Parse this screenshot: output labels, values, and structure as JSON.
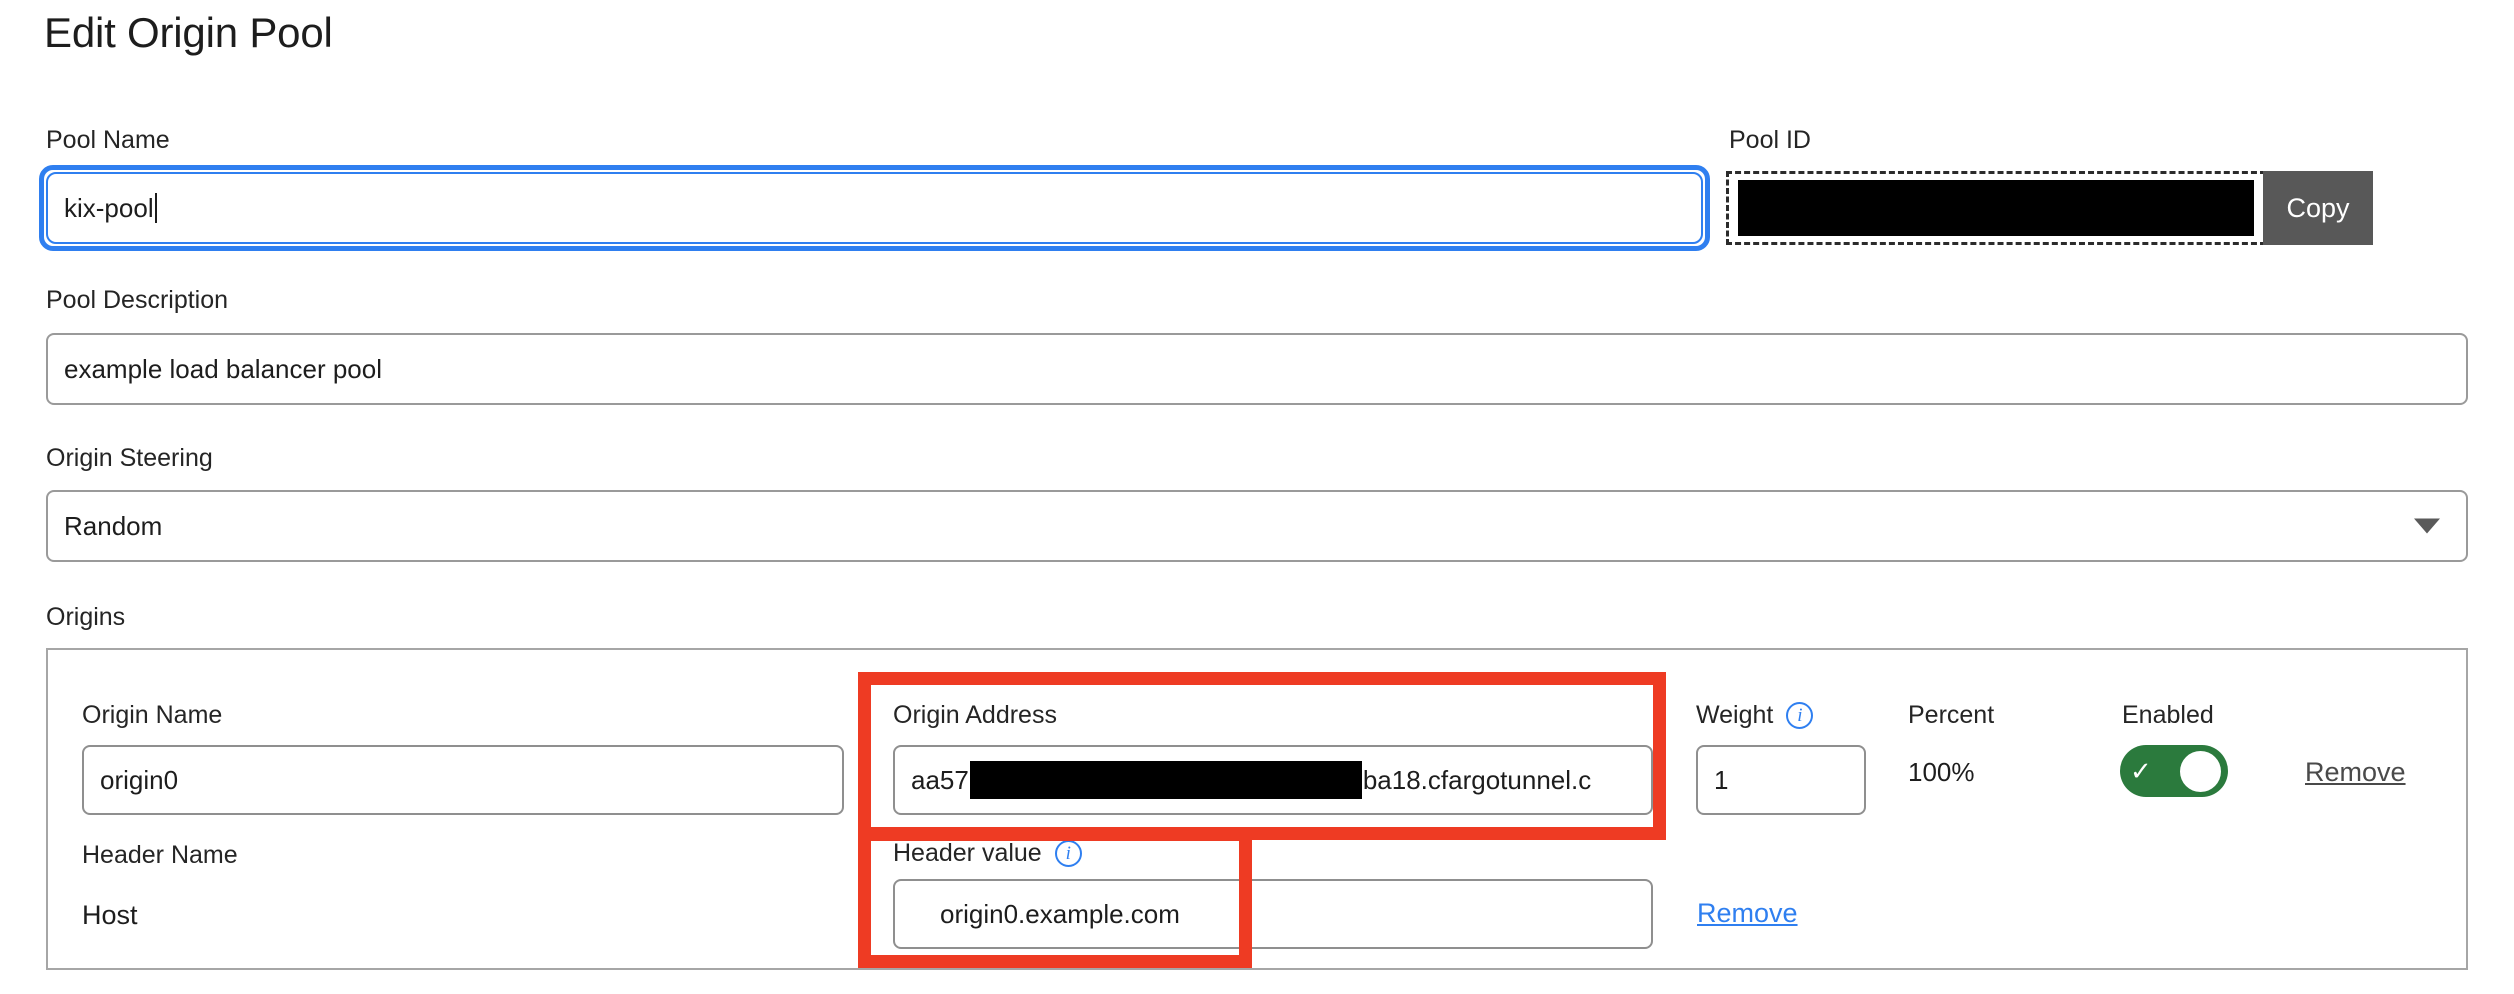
{
  "page": {
    "title": "Edit Origin Pool"
  },
  "pool_name": {
    "label": "Pool Name",
    "value": "kix-pool",
    "placeholder": "Pool Name"
  },
  "pool_id": {
    "label": "Pool ID",
    "value": "",
    "redacted": true,
    "copy_label": "Copy"
  },
  "pool_description": {
    "label": "Pool Description",
    "value": "example load balancer pool",
    "placeholder": "Pool Description"
  },
  "origin_steering": {
    "label": "Origin Steering",
    "value": "Random",
    "options": [
      "Random"
    ],
    "caret_icon": "chevron-down-icon"
  },
  "origins": {
    "section_label": "Origins",
    "columns": {
      "origin_name": "Origin Name",
      "origin_address": "Origin Address",
      "weight": "Weight",
      "percent": "Percent",
      "enabled": "Enabled"
    },
    "rows": [
      {
        "origin_name": "origin0",
        "origin_address_prefix": "aa57",
        "origin_address_suffix": "ba18.cfargotunnel.c",
        "origin_address_redacted": true,
        "weight": "1",
        "percent": "100%",
        "enabled": true,
        "remove_label": "Remove"
      }
    ],
    "header_row": {
      "header_name_label": "Header Name",
      "header_name_value": "Host",
      "header_value_label": "Header value",
      "header_value": "origin0.example.com",
      "remove_label": "Remove"
    },
    "info_icon": "info-icon"
  },
  "colors": {
    "focus_blue": "#2f7ff0",
    "highlight_red": "#ee3b23",
    "toggle_green": "#2b7a3d",
    "copy_gray": "#585858",
    "link_blue": "#2f7ff0"
  }
}
